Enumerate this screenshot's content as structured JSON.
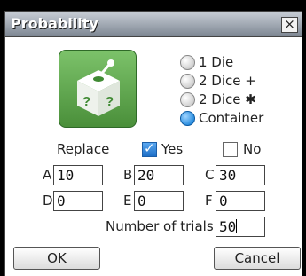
{
  "window": {
    "title": "Probability",
    "close_glyph": "×"
  },
  "source_options": [
    {
      "label": "1 Die",
      "selected": false
    },
    {
      "label": "2 Dice +",
      "selected": false
    },
    {
      "label": "2 Dice ✱",
      "selected": false
    },
    {
      "label": "Container",
      "selected": true
    }
  ],
  "replace": {
    "label": "Replace",
    "yes_label": "Yes",
    "no_label": "No",
    "yes_checked": true,
    "no_checked": false
  },
  "fields": [
    {
      "label": "A",
      "value": "10"
    },
    {
      "label": "B",
      "value": "20"
    },
    {
      "label": "C",
      "value": "30"
    },
    {
      "label": "D",
      "value": "0"
    },
    {
      "label": "E",
      "value": "0"
    },
    {
      "label": "F",
      "value": "0"
    }
  ],
  "trials": {
    "label": "Number of trials",
    "value": "50"
  },
  "buttons": {
    "ok": "OK",
    "cancel": "Cancel"
  },
  "icon": {
    "name": "container-dice-icon"
  },
  "colors": {
    "title_bar": "#8a929c",
    "logo_green": "#5aa04a",
    "selected_radio": "#2d8fe0",
    "checkbox_checked": "#1e6fc7"
  }
}
